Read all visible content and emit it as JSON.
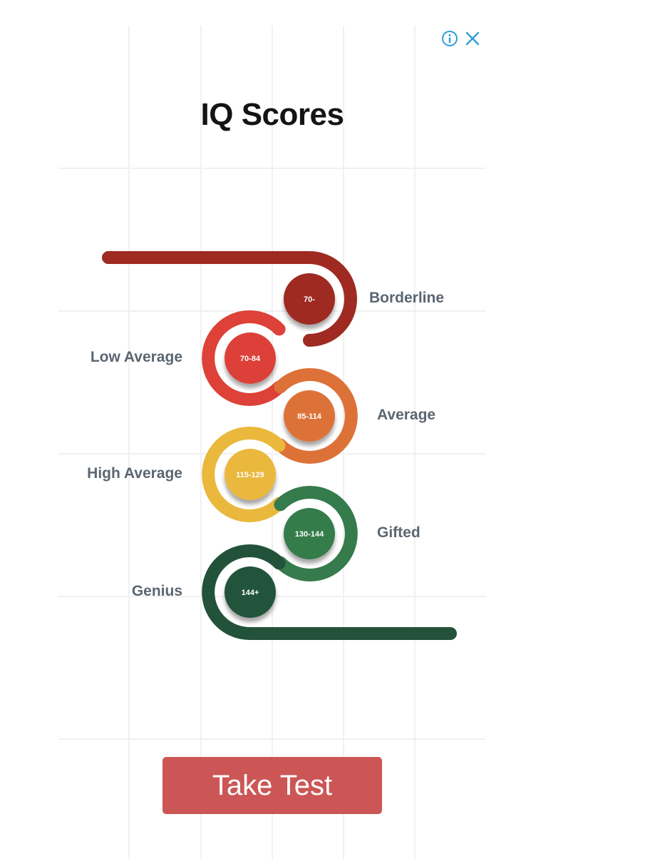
{
  "ad": {
    "info_icon": "info-circle-icon",
    "close_icon": "close-icon",
    "accent": "#2e9fd7"
  },
  "title": "IQ Scores",
  "chart_data": {
    "type": "path-infographic",
    "categories": [
      {
        "label": "Borderline",
        "range": "70-",
        "color": "#9e2a22"
      },
      {
        "label": "Low Average",
        "range": "70-84",
        "color": "#dd4138"
      },
      {
        "label": "Average",
        "range": "85-114",
        "color": "#dd7238"
      },
      {
        "label": "High Average",
        "range": "115-129",
        "color": "#eab83c"
      },
      {
        "label": "Gifted",
        "range": "130-144",
        "color": "#357b4c"
      },
      {
        "label": "Genius",
        "range": "144+",
        "color": "#23523a"
      }
    ]
  },
  "cta": {
    "label": "Take Test",
    "color": "#cc5656"
  }
}
